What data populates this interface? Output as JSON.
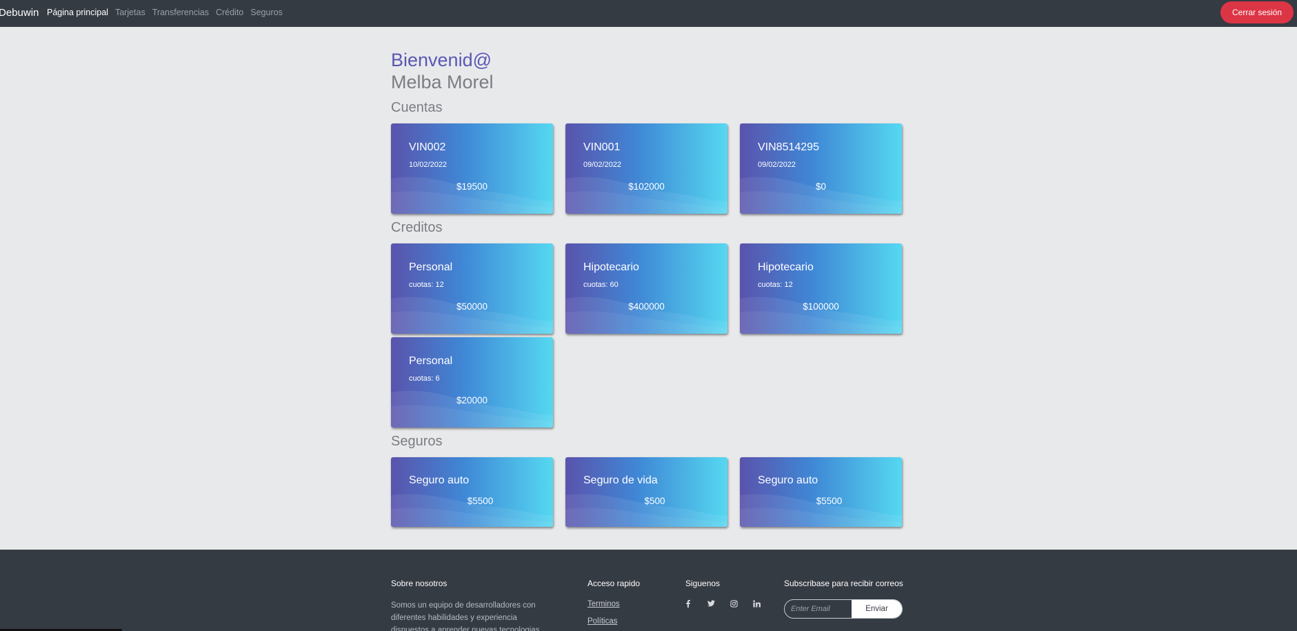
{
  "navbar": {
    "brand": "Debuwin",
    "links": [
      "Página principal",
      "Tarjetas",
      "Transferencias",
      "Crédito",
      "Seguros"
    ],
    "logout_label": "Cerrar sesión"
  },
  "welcome": {
    "greeting": "Bienvenid@",
    "name": "Melba Morel"
  },
  "sections": {
    "cuentas_title": "Cuentas",
    "creditos_title": "Creditos",
    "seguros_title": "Seguros"
  },
  "cuentas": [
    {
      "number": "VIN002",
      "date": "10/02/2022",
      "balance": "$19500"
    },
    {
      "number": "VIN001",
      "date": "09/02/2022",
      "balance": "$102000"
    },
    {
      "number": "VIN8514295",
      "date": "09/02/2022",
      "balance": "$0"
    }
  ],
  "creditos": [
    {
      "type": "Personal",
      "cuotas": "cuotas: 12",
      "amount": "$50000"
    },
    {
      "type": "Hipotecario",
      "cuotas": "cuotas: 60",
      "amount": "$400000"
    },
    {
      "type": "Hipotecario",
      "cuotas": "cuotas: 12",
      "amount": "$100000"
    },
    {
      "type": "Personal",
      "cuotas": "cuotas: 6",
      "amount": "$20000"
    }
  ],
  "seguros": [
    {
      "name": "Seguro auto",
      "amount": "$5500"
    },
    {
      "name": "Seguro de vida",
      "amount": "$500"
    },
    {
      "name": "Seguro auto",
      "amount": "$5500"
    }
  ],
  "footer": {
    "about_title": "Sobre nosotros",
    "about_text": "Somos un equipo de desarrolladores con diferentes habilidades y experiencia dispuestos a aprender nuevas tecnologias",
    "quick_title": "Acceso rapido",
    "quick_links": [
      "Terminos",
      "Políticas"
    ],
    "follow_title": "Siguenos",
    "social_icons": [
      "facebook-icon",
      "twitter-icon",
      "instagram-icon",
      "linkedin-icon"
    ],
    "subscribe_title": "Subscribase para recibir correos",
    "email_placeholder": "Enter Email",
    "submit_label": "Enviar"
  },
  "colors": {
    "navbar_bg": "#353b43",
    "logout_red": "#dc3545",
    "greeting_purple": "#5a57b5",
    "card_gradient_start": "#5a53ac",
    "card_gradient_end": "#55d8f1"
  }
}
